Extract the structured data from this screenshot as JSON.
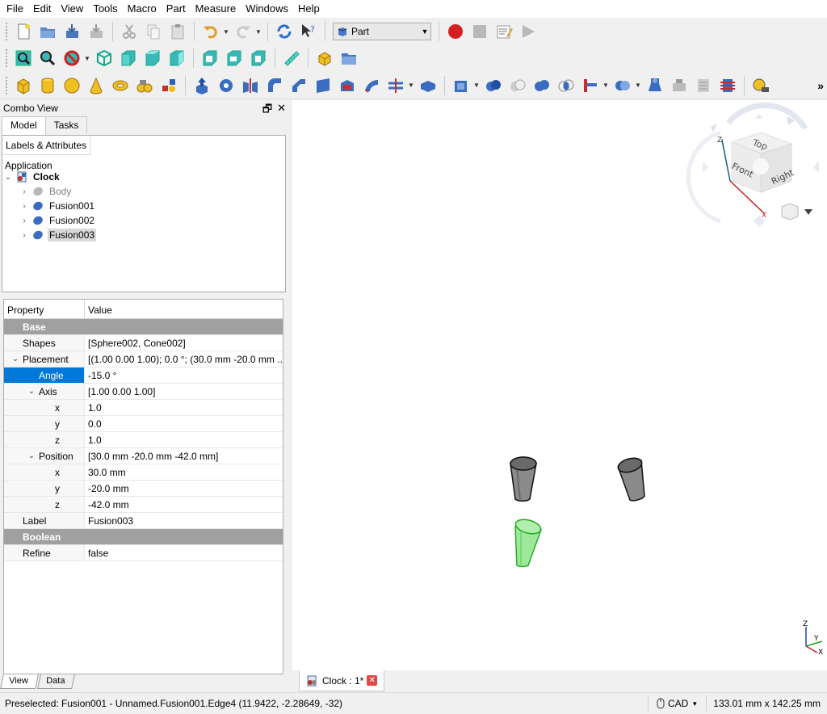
{
  "menu": [
    "File",
    "Edit",
    "View",
    "Tools",
    "Macro",
    "Part",
    "Measure",
    "Windows",
    "Help"
  ],
  "workbench": "Part",
  "combo": {
    "title": "Combo View",
    "tabs": [
      "Model",
      "Tasks"
    ],
    "tree_header": "Labels & Attributes",
    "application": "Application",
    "document": "Clock",
    "items": [
      "Body",
      "Fusion001",
      "Fusion002",
      "Fusion003"
    ],
    "selected_item": "Fusion003"
  },
  "properties": {
    "col_property": "Property",
    "col_value": "Value",
    "rows": [
      {
        "type": "group",
        "name": "Base"
      },
      {
        "type": "prop",
        "depth": 0,
        "name": "Shapes",
        "value": "[Sphere002, Cone002]"
      },
      {
        "type": "prop",
        "depth": 0,
        "name": "Placement",
        "value": "[(1.00 0.00 1.00); 0.0 °; (30.0 mm  -20.0 mm ...",
        "expanded": true
      },
      {
        "type": "prop",
        "depth": 1,
        "name": "Angle",
        "value": "-15.0 °",
        "editing": true
      },
      {
        "type": "prop",
        "depth": 1,
        "name": "Axis",
        "value": "[1.00 0.00 1.00]",
        "expanded": true
      },
      {
        "type": "prop",
        "depth": 2,
        "name": "x",
        "value": "1.0"
      },
      {
        "type": "prop",
        "depth": 2,
        "name": "y",
        "value": "0.0"
      },
      {
        "type": "prop",
        "depth": 2,
        "name": "z",
        "value": "1.0"
      },
      {
        "type": "prop",
        "depth": 1,
        "name": "Position",
        "value": "[30.0 mm  -20.0 mm  -42.0 mm]",
        "expanded": true
      },
      {
        "type": "prop",
        "depth": 2,
        "name": "x",
        "value": "30.0 mm"
      },
      {
        "type": "prop",
        "depth": 2,
        "name": "y",
        "value": "-20.0 mm"
      },
      {
        "type": "prop",
        "depth": 2,
        "name": "z",
        "value": "-42.0 mm"
      },
      {
        "type": "prop",
        "depth": 0,
        "name": "Label",
        "value": "Fusion003"
      },
      {
        "type": "group",
        "name": "Boolean"
      },
      {
        "type": "prop",
        "depth": 0,
        "name": "Refine",
        "value": "false"
      }
    ]
  },
  "bottom_tabs": [
    "View",
    "Data"
  ],
  "navcube": {
    "top": "Top",
    "front": "Front",
    "right": "Right"
  },
  "axes": {
    "x": "X",
    "y": "Y",
    "z": "Z"
  },
  "document_tab": "Clock : 1*",
  "status": {
    "message": "Preselected: Fusion001 - Unnamed.Fusion001.Edge4 (11.9422, -2.28649, -32)",
    "nav_style": "CAD",
    "dimensions": "133.01 mm x 142.25 mm"
  }
}
